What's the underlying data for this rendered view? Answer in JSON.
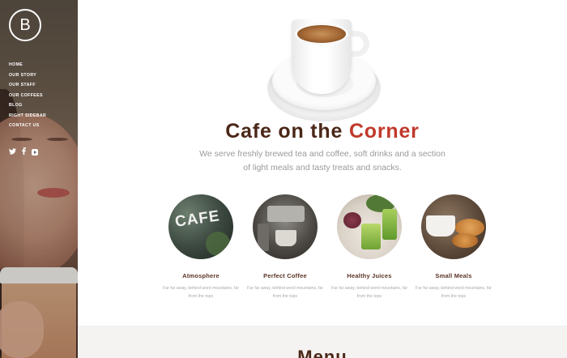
{
  "sidebar": {
    "logo_letter": "B",
    "nav": [
      "HOME",
      "OUR STORY",
      "OUR STAFF",
      "OUR COFFEES",
      "BLOG",
      "RIGHT SIDEBAR",
      "CONTACT US"
    ],
    "social": [
      "twitter-icon",
      "facebook-icon",
      "youtube-icon"
    ]
  },
  "hero": {
    "title_part1": "Cafe on the",
    "title_part2": "Corner",
    "subtitle": "We serve freshly brewed tea and coffee, soft drinks and a section of light meals and tasty treats and snacks."
  },
  "features": [
    {
      "title": "Atmosphere",
      "image_text": "CAFE",
      "desc": "Far far away, behind word mountains, far from the tops"
    },
    {
      "title": "Perfect Coffee",
      "desc": "Far far away, behind word mountains, far from the tops"
    },
    {
      "title": "Healthy Juices",
      "desc": "Far far away, behind word mountains, far from the tops"
    },
    {
      "title": "Small Meals",
      "desc": "Far far away, behind word mountains, far from the tops"
    }
  ],
  "menu_section": {
    "heading": "Menu"
  },
  "colors": {
    "accent": "#c0392b",
    "heading_brown": "#4b2717"
  }
}
